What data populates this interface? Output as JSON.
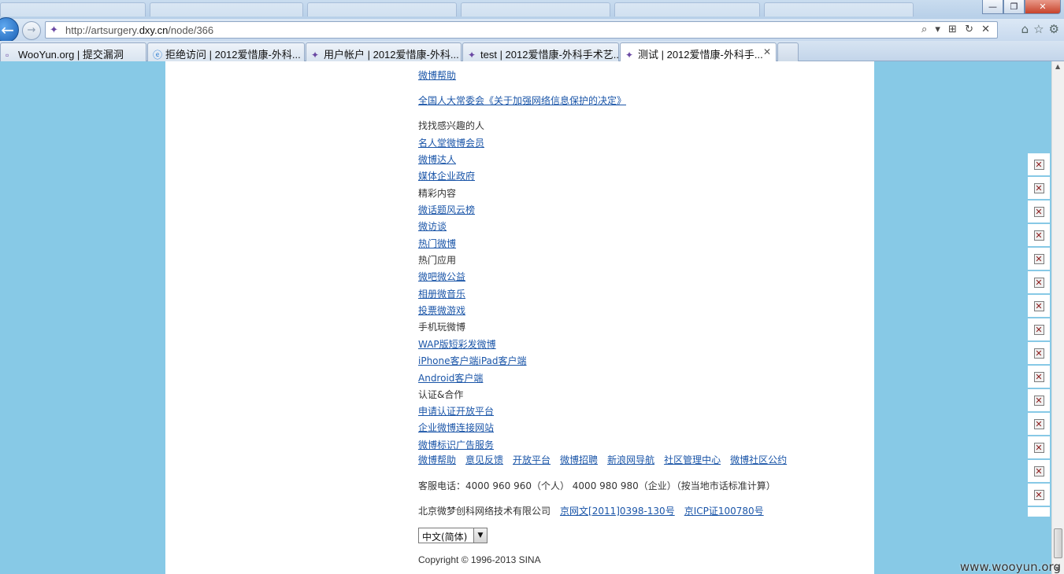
{
  "browser": {
    "url_prefix": "http://artsurgery.",
    "url_domain": "dxy.cn",
    "url_suffix": "/node/366",
    "address_tools": "⌕ ▾ ⊞ ↻ ✕",
    "window_buttons": {
      "minimize": "—",
      "restore": "❐",
      "close": "✕"
    },
    "tabs": [
      {
        "label": "WooYun.org | 提交漏洞",
        "icon": "page-icon"
      },
      {
        "label": "拒绝访问 | 2012爱惜康-外科...",
        "icon": "ie-icon"
      },
      {
        "label": "用户帐户 | 2012爱惜康-外科...",
        "icon": "butterfly-icon"
      },
      {
        "label": "test | 2012爱惜康-外科手术艺...",
        "icon": "butterfly-icon"
      },
      {
        "label": "测试 | 2012爱惜康-外科手...",
        "icon": "butterfly-icon",
        "active": true
      }
    ]
  },
  "content": {
    "links_top": [
      {
        "text": "微博帮助"
      },
      {
        "text": "全国人大常委会《关于加强网络信息保护的决定》"
      }
    ],
    "sections": [
      {
        "heading": "找找感兴趣的人",
        "items": [
          "名人堂微博会员",
          "微博达人",
          "媒体企业政府"
        ]
      },
      {
        "heading": "精彩内容",
        "items": [
          "微话题风云榜",
          "微访谈",
          "热门微博"
        ]
      },
      {
        "heading": "热门应用",
        "items": [
          "微吧微公益",
          "相册微音乐",
          "投票微游戏"
        ]
      },
      {
        "heading": "手机玩微博",
        "items": [
          "WAP版短彩发微博",
          "iPhone客户端iPad客户端",
          "Android客户端"
        ]
      },
      {
        "heading": "认证&合作",
        "items": [
          "申请认证开放平台",
          "企业微博连接网站",
          "微博标识广告服务"
        ]
      }
    ],
    "footer_links": [
      "微博帮助",
      "意见反馈",
      "开放平台",
      "微博招聘",
      "新浪网导航",
      "社区管理中心",
      "微博社区公约"
    ],
    "hotline": "客服电话：4000 960 960（个人） 4000 980 980（企业）（按当地市话标准计算）",
    "company": "北京微梦创科网络技术有限公司",
    "license_1": "京网文[2011]0398-130号",
    "license_2": "京ICP证100780号",
    "language": "中文(简体)",
    "copyright": "Copyright © 1996-2013 SINA"
  },
  "watermark": "www.wooyun.org"
}
